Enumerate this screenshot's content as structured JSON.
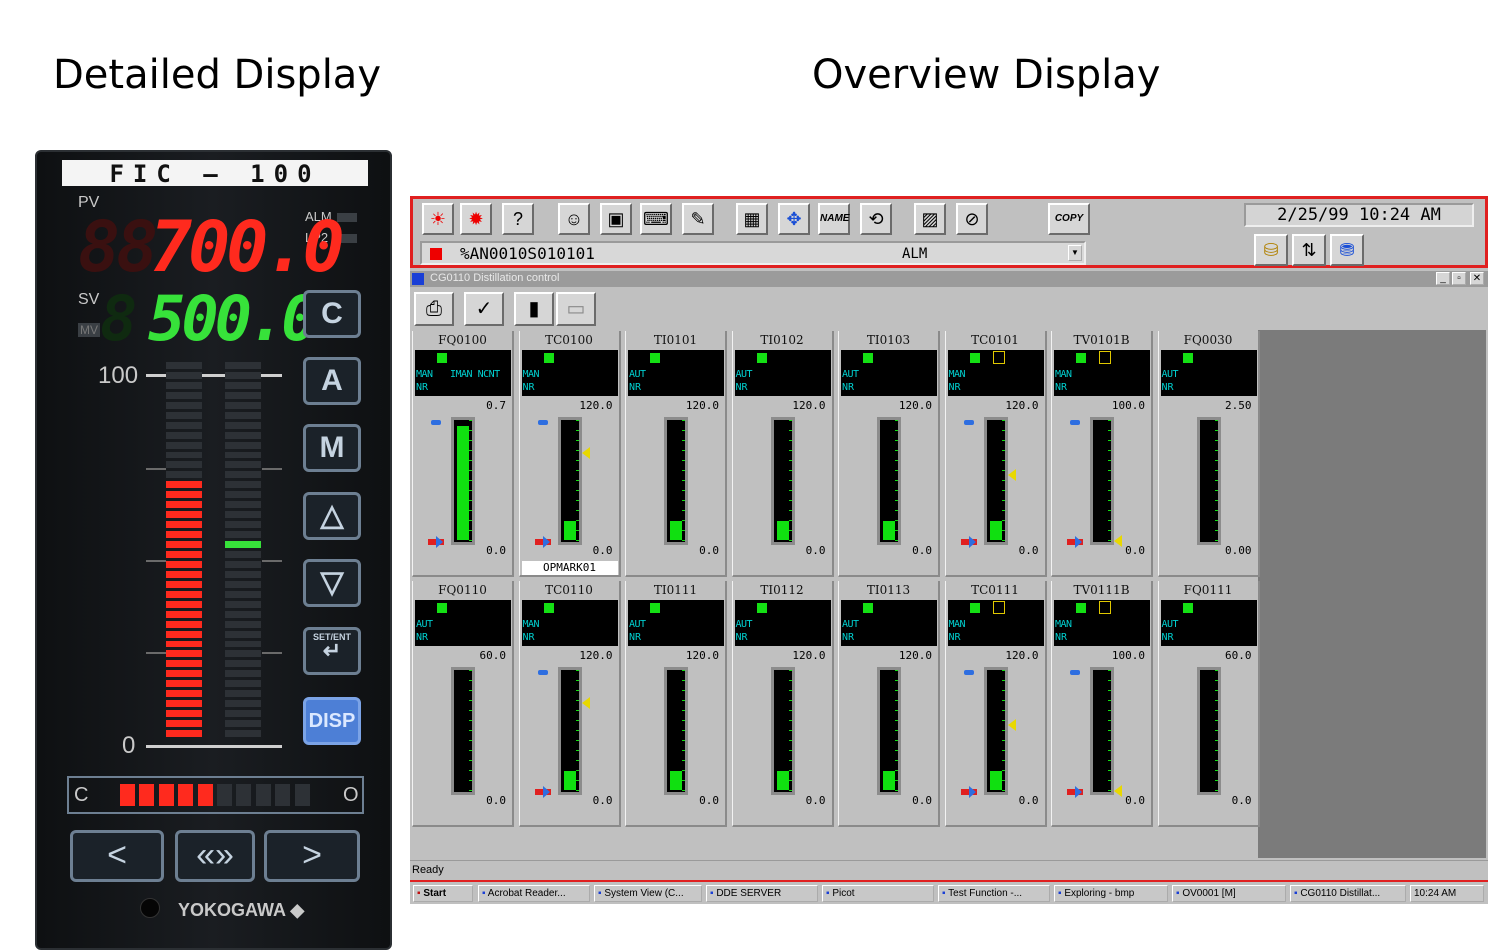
{
  "headings": {
    "detailed": "Detailed Display",
    "overview": "Overview Display"
  },
  "faceplate": {
    "tag": "FIC – 100",
    "pv_label": "PV",
    "sv_label": "SV",
    "mv_label": "MV",
    "alm_label": "ALM",
    "lp2_label": "LP2",
    "pv_value": "700.0",
    "sv_value": "500.0",
    "scale_high": "100",
    "scale_low": "0",
    "buttons": {
      "c": "C",
      "a": "A",
      "m": "M",
      "up": "△",
      "down": "▽",
      "setent": "SET/ENT",
      "disp": "DISP"
    },
    "co_left": "C",
    "co_right": "O",
    "nav": {
      "left": "<",
      "both": "«»",
      "right": ">"
    },
    "brand": "YOKOGAWA ◆"
  },
  "toolbar": {
    "copy_label": "COPY",
    "datetime": "2/25/99 10:24 AM",
    "message": "%AN0010S010101",
    "message_type": "ALM"
  },
  "window": {
    "title": "CG0110 Distillation control"
  },
  "panels": [
    {
      "tag": "FQ0100",
      "mode": "MAN",
      "sub": "NR",
      "extra": "IMAN NCNT",
      "hi": "0.7",
      "lo": "0.0",
      "fill": 0.97,
      "sp": 0.98,
      "mv": 0.05,
      "trg": null,
      "ymark": false,
      "mark": null
    },
    {
      "tag": "TC0100",
      "mode": "MAN",
      "sub": "NR",
      "extra": "",
      "hi": "120.0",
      "lo": "0.0",
      "fill": 0.16,
      "sp": 0.98,
      "mv": 0.05,
      "trg": 0.72,
      "ymark": false,
      "mark": "OPMARK01"
    },
    {
      "tag": "TI0101",
      "mode": "AUT",
      "sub": "NR",
      "extra": "",
      "hi": "120.0",
      "lo": "0.0",
      "fill": 0.16,
      "sp": null,
      "mv": null,
      "trg": null,
      "ymark": false,
      "mark": null
    },
    {
      "tag": "TI0102",
      "mode": "AUT",
      "sub": "NR",
      "extra": "",
      "hi": "120.0",
      "lo": "0.0",
      "fill": 0.16,
      "sp": null,
      "mv": null,
      "trg": null,
      "ymark": false,
      "mark": null
    },
    {
      "tag": "TI0103",
      "mode": "AUT",
      "sub": "NR",
      "extra": "",
      "hi": "120.0",
      "lo": "0.0",
      "fill": 0.16,
      "sp": null,
      "mv": null,
      "trg": null,
      "ymark": false,
      "mark": null
    },
    {
      "tag": "TC0101",
      "mode": "MAN",
      "sub": "NR",
      "extra": "",
      "hi": "120.0",
      "lo": "0.0",
      "fill": 0.16,
      "sp": 0.98,
      "mv": 0.05,
      "trg": 0.55,
      "ymark": true,
      "mark": null
    },
    {
      "tag": "TV0101B",
      "mode": "MAN",
      "sub": "NR",
      "extra": "",
      "hi": "100.0",
      "lo": "0.0",
      "fill": 0.0,
      "sp": 0.98,
      "mv": 0.05,
      "trg": 0.03,
      "ymark": true,
      "mark": null
    },
    {
      "tag": "FQ0030",
      "mode": "AUT",
      "sub": "NR",
      "extra": "",
      "hi": "2.50",
      "lo": "0.00",
      "fill": 0.0,
      "sp": null,
      "mv": null,
      "trg": null,
      "ymark": false,
      "mark": null
    },
    {
      "tag": "FQ0110",
      "mode": "AUT",
      "sub": "NR",
      "extra": "",
      "hi": "60.0",
      "lo": "0.0",
      "fill": 0.0,
      "sp": null,
      "mv": null,
      "trg": null,
      "ymark": false,
      "mark": null
    },
    {
      "tag": "TC0110",
      "mode": "MAN",
      "sub": "NR",
      "extra": "",
      "hi": "120.0",
      "lo": "0.0",
      "fill": 0.16,
      "sp": 0.98,
      "mv": 0.05,
      "trg": 0.72,
      "ymark": false,
      "mark": null
    },
    {
      "tag": "TI0111",
      "mode": "AUT",
      "sub": "NR",
      "extra": "",
      "hi": "120.0",
      "lo": "0.0",
      "fill": 0.16,
      "sp": null,
      "mv": null,
      "trg": null,
      "ymark": false,
      "mark": null
    },
    {
      "tag": "TI0112",
      "mode": "AUT",
      "sub": "NR",
      "extra": "",
      "hi": "120.0",
      "lo": "0.0",
      "fill": 0.16,
      "sp": null,
      "mv": null,
      "trg": null,
      "ymark": false,
      "mark": null
    },
    {
      "tag": "TI0113",
      "mode": "AUT",
      "sub": "NR",
      "extra": "",
      "hi": "120.0",
      "lo": "0.0",
      "fill": 0.16,
      "sp": null,
      "mv": null,
      "trg": null,
      "ymark": false,
      "mark": null
    },
    {
      "tag": "TC0111",
      "mode": "MAN",
      "sub": "NR",
      "extra": "",
      "hi": "120.0",
      "lo": "0.0",
      "fill": 0.16,
      "sp": 0.98,
      "mv": 0.05,
      "trg": 0.55,
      "ymark": true,
      "mark": null
    },
    {
      "tag": "TV0111B",
      "mode": "MAN",
      "sub": "NR",
      "extra": "",
      "hi": "100.0",
      "lo": "0.0",
      "fill": 0.0,
      "sp": 0.98,
      "mv": 0.05,
      "trg": 0.03,
      "ymark": true,
      "mark": null
    },
    {
      "tag": "FQ0111",
      "mode": "AUT",
      "sub": "NR",
      "extra": "",
      "hi": "60.0",
      "lo": "0.0",
      "fill": 0.0,
      "sp": null,
      "mv": null,
      "trg": null,
      "ymark": false,
      "mark": null
    }
  ],
  "status": "Ready",
  "taskbar": [
    {
      "label": "Start",
      "icon": "windows-flag-icon"
    },
    {
      "label": "Acrobat Reader...",
      "icon": "acrobat-icon"
    },
    {
      "label": "System View (C...",
      "icon": "system-view-icon"
    },
    {
      "label": "DDE SERVER",
      "icon": "dde-server-icon"
    },
    {
      "label": "Picot",
      "icon": "picot-icon"
    },
    {
      "label": "Test Function -...",
      "icon": "test-function-icon"
    },
    {
      "label": "Exploring - bmp",
      "icon": "explorer-icon"
    },
    {
      "label": "OV0001 [M]",
      "icon": "overview-icon"
    },
    {
      "label": "CG0110 Distillat...",
      "icon": "control-group-icon"
    },
    {
      "label": "10:24 AM",
      "icon": "clock"
    }
  ],
  "colors": {
    "pv": "#ff2a1e",
    "sv": "#37e23a",
    "bar_fill": "#10e010",
    "mode_text": "#00d0d0",
    "highlight_box": "#e02020"
  }
}
